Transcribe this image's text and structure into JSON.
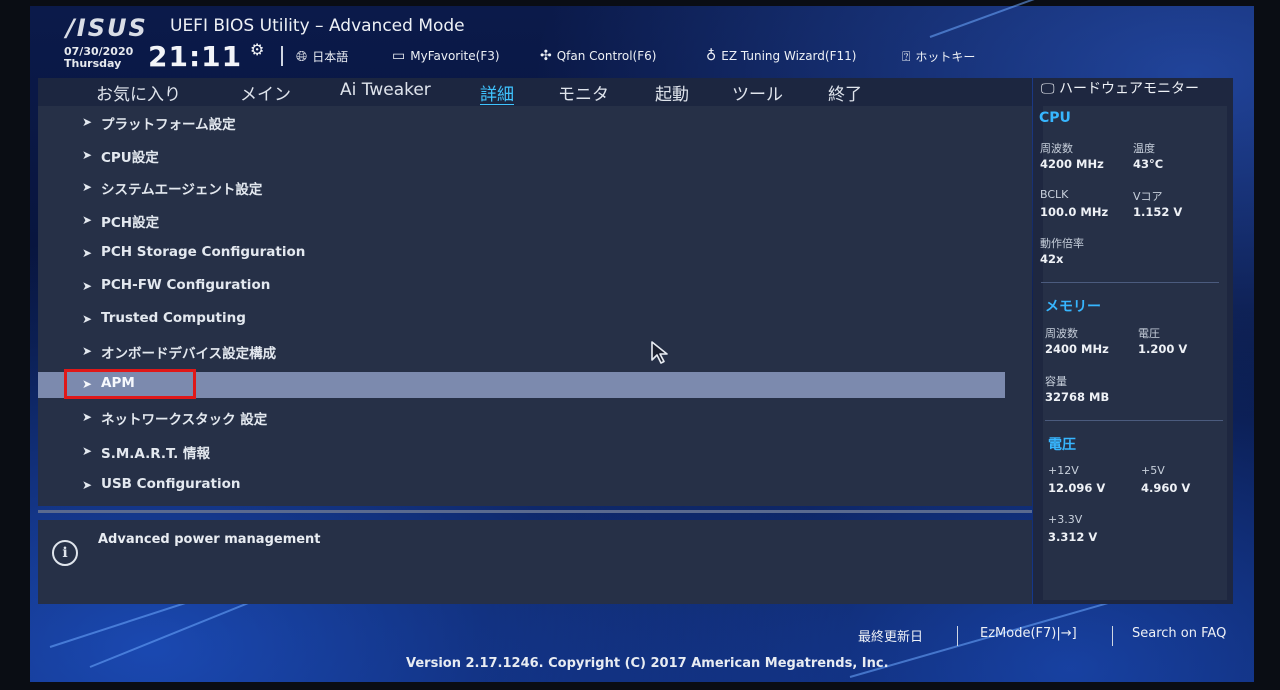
{
  "header": {
    "brand": "/ISUS",
    "title": "UEFI BIOS Utility – Advanced Mode",
    "date": "07/30/2020",
    "weekday": "Thursday",
    "time": "21:11",
    "toolbar": [
      {
        "icon": "globe-icon",
        "label": "日本語"
      },
      {
        "icon": "favorite-icon",
        "label": "MyFavorite(F3)"
      },
      {
        "icon": "fan-icon",
        "label": "Qfan Control(F6)"
      },
      {
        "icon": "bulb-icon",
        "label": "EZ Tuning Wizard(F11)"
      },
      {
        "icon": "help-icon",
        "label": "ホットキー"
      }
    ]
  },
  "tabs": [
    {
      "label": "お気に入り"
    },
    {
      "label": "メイン"
    },
    {
      "label": "Ai Tweaker"
    },
    {
      "label": "詳細"
    },
    {
      "label": "モニタ"
    },
    {
      "label": "起動"
    },
    {
      "label": "ツール"
    },
    {
      "label": "終了"
    }
  ],
  "active_tab": "詳細",
  "menu": [
    "プラットフォーム設定",
    "CPU設定",
    "システムエージェント設定",
    "PCH設定",
    "PCH Storage Configuration",
    "PCH-FW Configuration",
    "Trusted Computing",
    "オンボードデバイス設定構成",
    "APM",
    "ネットワークスタック 設定",
    "S.M.A.R.T. 情報",
    "USB Configuration"
  ],
  "selected_item": "APM",
  "help_text": "Advanced power management",
  "hw_monitor": {
    "title": "ハードウェアモニター",
    "cpu": {
      "section": "CPU",
      "freq_label": "周波数",
      "freq": "4200 MHz",
      "temp_label": "温度",
      "temp": "43°C",
      "bclk_label": "BCLK",
      "bclk": "100.0 MHz",
      "vcore_label": "Vコア",
      "vcore": "1.152 V",
      "ratio_label": "動作倍率",
      "ratio": "42x"
    },
    "memory": {
      "section": "メモリー",
      "freq_label": "周波数",
      "freq": "2400 MHz",
      "volt_label": "電圧",
      "volt": "1.200 V",
      "cap_label": "容量",
      "cap": "32768 MB"
    },
    "voltage": {
      "section": "電圧",
      "v12_label": "+12V",
      "v12": "12.096 V",
      "v5_label": "+5V",
      "v5": "4.960 V",
      "v33_label": "+3.3V",
      "v33": "3.312 V"
    }
  },
  "footer": {
    "last_modified": "最終更新日",
    "ezmode": "EzMode(F7)|→]",
    "search": "Search on FAQ",
    "version": "Version 2.17.1246. Copyright (C) 2017 American Megatrends, Inc."
  },
  "colors": {
    "accent": "#3fc4ff",
    "section": "#37b6ff",
    "selection": "#7c8aae",
    "highlight_box": "#e01818"
  }
}
